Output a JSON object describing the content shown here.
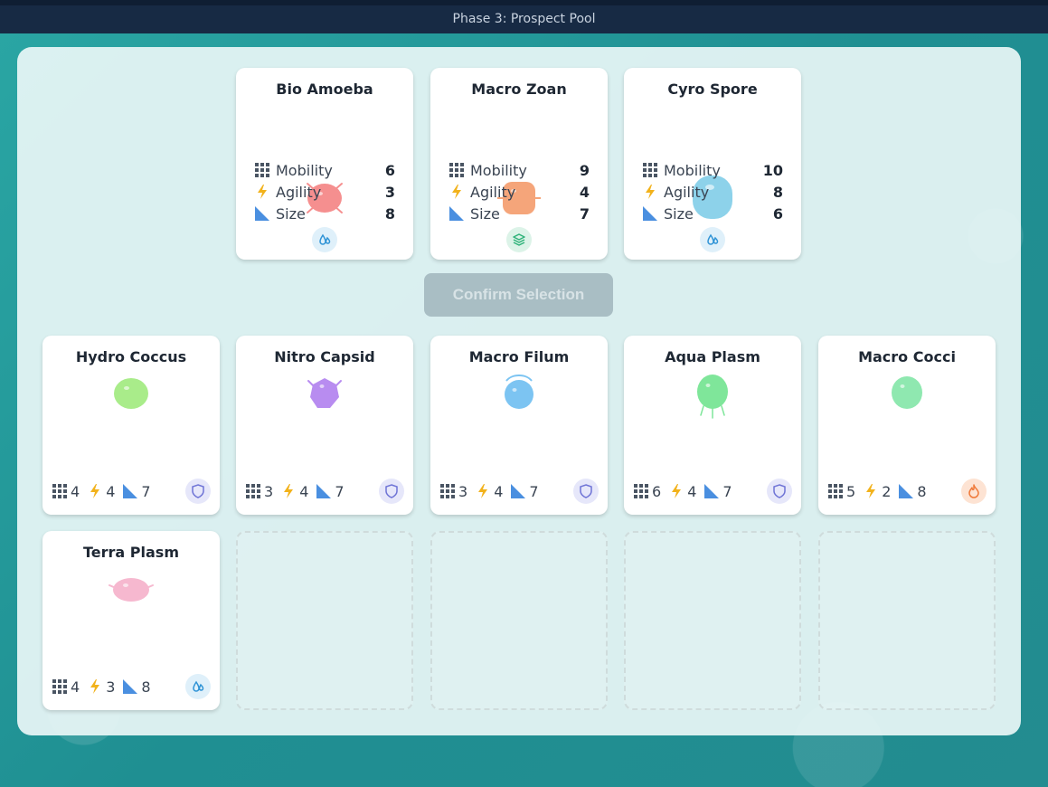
{
  "header": {
    "title": "Phase 3: Prospect Pool"
  },
  "stat_labels": {
    "mobility": "Mobility",
    "agility": "Agility",
    "size": "Size"
  },
  "selection": [
    {
      "name": "Bio Amoeba",
      "color": "#f58f8f",
      "mobility": "6",
      "agility": "3",
      "size": "8",
      "type": "water-drop-icon"
    },
    {
      "name": "Macro Zoan",
      "color": "#f5a57a",
      "mobility": "9",
      "agility": "4",
      "size": "7",
      "type": "layers-icon"
    },
    {
      "name": "Cyro Spore",
      "color": "#8dd2ea",
      "mobility": "10",
      "agility": "8",
      "size": "6",
      "type": "water-drop-icon"
    }
  ],
  "confirm_button": {
    "label": "Confirm Selection"
  },
  "pool": [
    {
      "name": "Hydro Coccus",
      "color": "#a9ec8a",
      "mobility": "4",
      "agility": "4",
      "size": "7",
      "type": "shield-icon"
    },
    {
      "name": "Nitro Capsid",
      "color": "#b88cf0",
      "mobility": "3",
      "agility": "4",
      "size": "7",
      "type": "shield-icon"
    },
    {
      "name": "Macro Filum",
      "color": "#7cc4f2",
      "mobility": "3",
      "agility": "4",
      "size": "7",
      "type": "shield-icon"
    },
    {
      "name": "Aqua Plasm",
      "color": "#7fe69a",
      "mobility": "6",
      "agility": "4",
      "size": "7",
      "type": "shield-icon"
    },
    {
      "name": "Macro Cocci",
      "color": "#8fe8b0",
      "mobility": "5",
      "agility": "2",
      "size": "8",
      "type": "flame-icon"
    },
    {
      "name": "Terra Plasm",
      "color": "#f6b8cf",
      "mobility": "4",
      "agility": "3",
      "size": "8",
      "type": "water-drop-icon"
    }
  ],
  "colors": {
    "accent_water": "#2f93d6",
    "accent_shield": "#6f74d6",
    "accent_flame": "#f07a3a",
    "accent_layers": "#2fb27a",
    "bolt": "#f2b21b",
    "size_triangle": "#4a8fe0"
  }
}
